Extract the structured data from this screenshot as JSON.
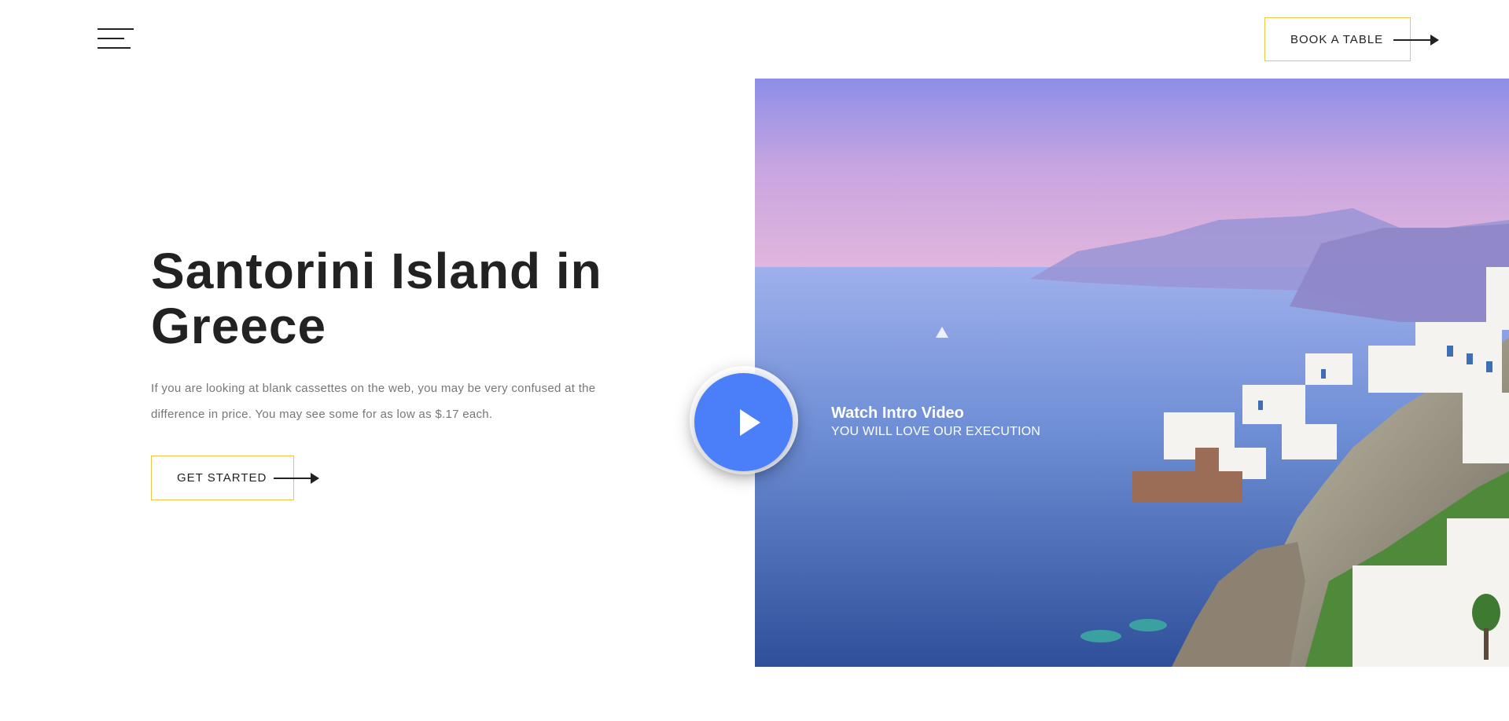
{
  "header": {
    "menu_icon": "hamburger-menu-icon",
    "book_label": "BOOK A TABLE",
    "arrow_icon": "arrow-right-icon"
  },
  "hero": {
    "title": "Santorini Island in Greece",
    "description": "If you are looking at blank cassettes on the web, you may be very confused at the difference in price. You may see some for as low as $.17 each.",
    "cta_label": "GET STARTED"
  },
  "video": {
    "title": "Watch Intro Video",
    "subtitle": "YOU WILL LOVE OUR EXECUTION",
    "play_icon": "play-icon"
  },
  "colors": {
    "accent_border": "#f4c542",
    "play_button": "#4b7ffa",
    "title_text": "#222222",
    "body_text": "#777777"
  }
}
